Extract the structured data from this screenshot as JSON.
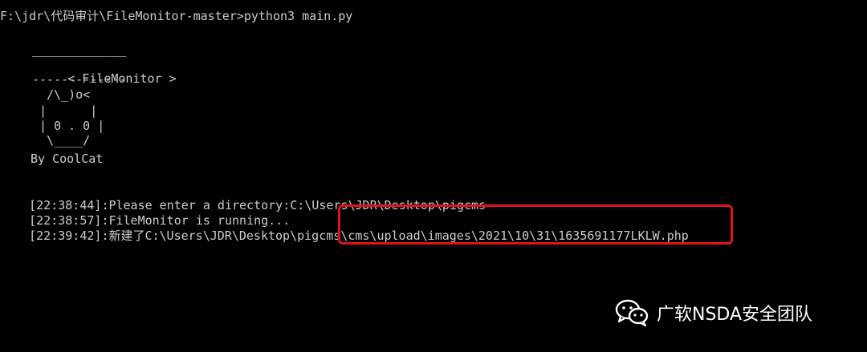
{
  "console": {
    "prompt_line": "F:\\jdr\\代码审计\\FileMonitor-master>python3 main.py",
    "banner": {
      "title": "FileMonitor",
      "top_rule": "_____________",
      "rule": "-------------",
      "art_ears": "/\\_)o<",
      "art_face": "0 . 0",
      "art_bottom": "\\____/",
      "author": "By CoolCat"
    },
    "log_lines": [
      {
        "time": "[22:38:44]",
        "text": ":Please enter a directory:C:\\Users\\JDR\\Desktop\\pigcms"
      },
      {
        "time": "[22:38:57]",
        "text": ":FileMonitor is running..."
      },
      {
        "time": "[22:39:42]",
        "text_prefix": ":新建了C:\\Users\\JDR\\Desktop\\pigcms",
        "text_highlight": "\\cms\\upload\\images\\2021\\10\\31\\1635691177LKLW.php"
      }
    ]
  },
  "watermark": {
    "text": "广软NSDA安全团队",
    "icon": "wechat-icon"
  },
  "colors": {
    "background": "#000000",
    "foreground": "#cccccc",
    "highlight_border": "#e0141a",
    "watermark": "#ffffff"
  }
}
